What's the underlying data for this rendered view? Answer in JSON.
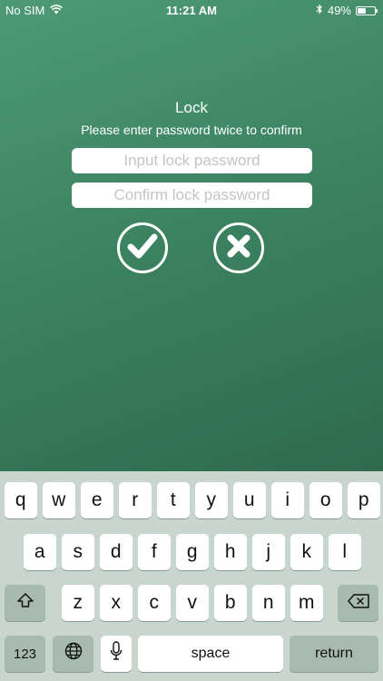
{
  "status_bar": {
    "carrier": "No SIM",
    "time": "11:21 AM",
    "battery": "49%",
    "battery_level": 0.49
  },
  "lock": {
    "title": "Lock",
    "subtitle": "Please enter password twice to confirm",
    "input_placeholder": "Input lock password",
    "confirm_placeholder": "Confirm lock password"
  },
  "keyboard": {
    "row1": [
      "q",
      "w",
      "e",
      "r",
      "t",
      "y",
      "u",
      "i",
      "o",
      "p"
    ],
    "row2": [
      "a",
      "s",
      "d",
      "f",
      "g",
      "h",
      "j",
      "k",
      "l"
    ],
    "row3": [
      "z",
      "x",
      "c",
      "v",
      "b",
      "n",
      "m"
    ],
    "numbers_label": "123",
    "space_label": "space",
    "return_label": "return"
  }
}
